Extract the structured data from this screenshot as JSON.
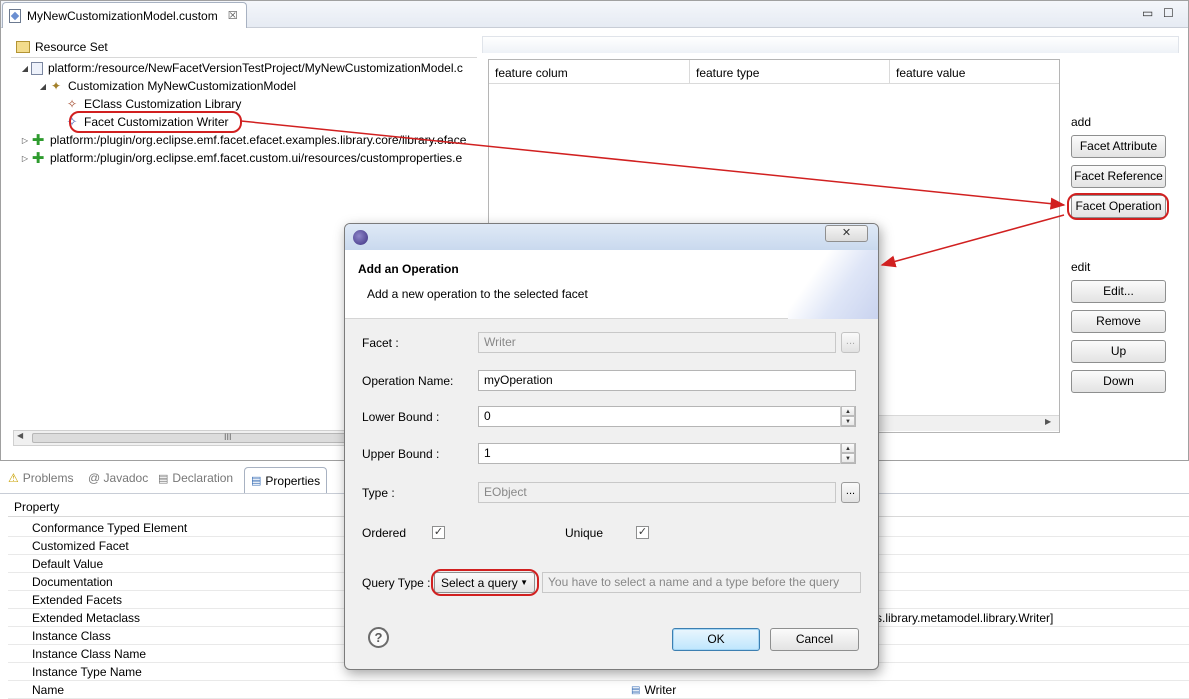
{
  "editor": {
    "tab_title": "MyNewCustomizationModel.custom",
    "tab_close": "☒",
    "minimize": "▭",
    "maximize": "☐",
    "resource_set_label": "Resource Set",
    "tree": {
      "row1": "platform:/resource/NewFacetVersionTestProject/MyNewCustomizationModel.c",
      "row2": "Customization MyNewCustomizationModel",
      "row3": "EClass Customization Library",
      "row4": "Facet Customization Writer",
      "row5": "platform:/plugin/org.eclipse.emf.facet.efacet.examples.library.core/library.eface",
      "row6": "platform:/plugin/org.eclipse.emf.facet.custom.ui/resources/customproperties.e"
    },
    "scroll_grip": "III",
    "table": {
      "columns": [
        "feature colum",
        "feature type",
        "feature value"
      ]
    },
    "add_label": "add",
    "edit_label": "edit",
    "buttons": {
      "facet_attribute": "Facet Attribute",
      "facet_reference": "Facet Reference",
      "facet_operation": "Facet Operation",
      "edit": "Edit...",
      "remove": "Remove",
      "up": "Up",
      "down": "Down"
    }
  },
  "bottom": {
    "tabs": [
      "Problems",
      "@ Javadoc",
      "Declaration",
      "Properties"
    ],
    "header": "Property",
    "rows": [
      "Conformance Typed Element",
      "Customized Facet",
      "Default Value",
      "Documentation",
      "Extended Facets",
      "Extended Metaclass",
      "Instance Class",
      "Instance Class Name",
      "Instance Type Name",
      "Name"
    ],
    "extended_metaclass_value": "s.library.metamodel.library.Writer]",
    "name_value": "Writer"
  },
  "dialog": {
    "title": "Add an Operation",
    "description": "Add a new operation to the selected facet",
    "close": "✕",
    "facet_label": "Facet :",
    "facet_value": "Writer",
    "dots": "...",
    "operation_name_label": "Operation Name:",
    "operation_name_value": "myOperation",
    "lower_bound_label": "Lower Bound :",
    "lower_bound_value": "0",
    "upper_bound_label": "Upper Bound :",
    "upper_bound_value": "1",
    "type_label": "Type :",
    "type_value": "EObject",
    "ordered_label": "Ordered",
    "unique_label": "Unique",
    "ordered_checked": true,
    "unique_checked": true,
    "query_type_label": "Query Type :",
    "query_type_value": "Select a query",
    "query_placeholder": "You have to select a name and a type before the query",
    "help": "?",
    "ok": "OK",
    "cancel": "Cancel"
  },
  "colors": {
    "highlight": "#d12020"
  }
}
